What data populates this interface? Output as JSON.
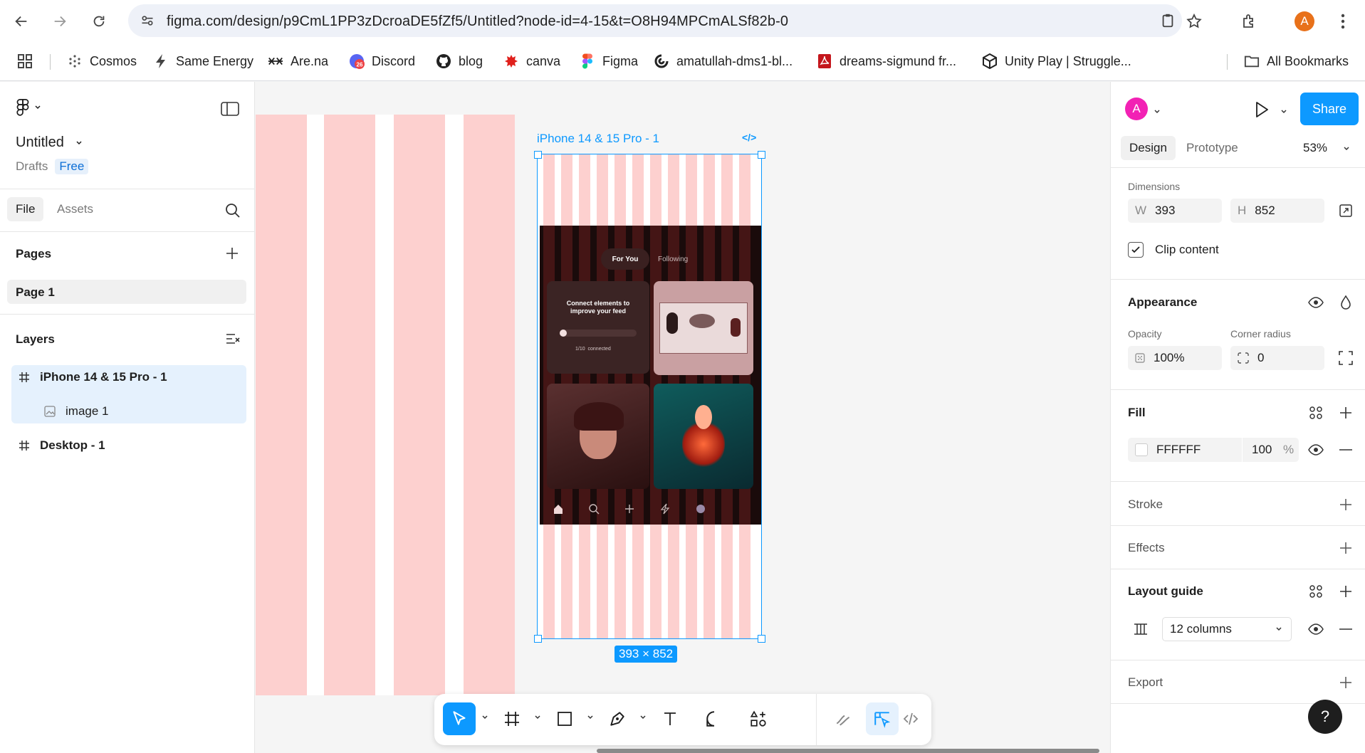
{
  "browser": {
    "url": "figma.com/design/p9CmL1PP3zDcroaDE5fZf5/Untitled?node-id=4-15&t=O8H94MPCmALSf82b-0",
    "profile_initial": "A",
    "bookmarks": [
      {
        "label": "Cosmos",
        "icon": "cosmos-icon"
      },
      {
        "label": "Same Energy",
        "icon": "bolt-icon"
      },
      {
        "label": "Are.na",
        "icon": "arena-icon"
      },
      {
        "label": "Discord",
        "icon": "discord-icon",
        "badge": "26"
      },
      {
        "label": "blog",
        "icon": "github-icon"
      },
      {
        "label": "canva",
        "icon": "canva-icon"
      },
      {
        "label": "Figma",
        "icon": "figma-icon"
      },
      {
        "label": "amatullah-dms1-bl...",
        "icon": "vercel-icon"
      },
      {
        "label": "dreams-sigmund fr...",
        "icon": "pdf-icon"
      },
      {
        "label": "Unity Play | Struggle...",
        "icon": "unity-icon"
      }
    ],
    "all_bookmarks": "All Bookmarks"
  },
  "file": {
    "title": "Untitled",
    "location": "Drafts",
    "plan": "Free"
  },
  "left_tabs": {
    "file": "File",
    "assets": "Assets"
  },
  "pages": {
    "title": "Pages",
    "items": [
      {
        "label": "Page 1"
      }
    ]
  },
  "layers": {
    "title": "Layers",
    "items": [
      {
        "label": "iPhone 14 & 15 Pro - 1",
        "type": "frame",
        "selected": true
      },
      {
        "label": "image 1",
        "type": "image",
        "selected": true
      },
      {
        "label": "Desktop - 1",
        "type": "frame",
        "selected": false
      }
    ]
  },
  "canvas": {
    "frame_label": "iPhone 14 & 15 Pro - 1",
    "frame_code_glyph": "</>",
    "dimension_badge": "393 × 852",
    "app": {
      "tab_active": "For You",
      "tab_inactive": "Following",
      "card_title": "Connect elements to improve your feed",
      "card_progress": "1/10",
      "card_progress_suffix": "connected"
    }
  },
  "toolbar": {
    "tools": [
      "move-tool",
      "frame-tool",
      "rectangle-tool",
      "pen-tool",
      "text-tool",
      "comment-tool",
      "actions-tool"
    ],
    "modes": [
      "draw-mode",
      "design-mode",
      "dev-mode"
    ],
    "active_tool": "move-tool"
  },
  "right": {
    "share": "Share",
    "avatar_initial": "A",
    "tabs": {
      "design": "Design",
      "prototype": "Prototype"
    },
    "zoom": "53%",
    "dimensions": {
      "label": "Dimensions",
      "w_label": "W",
      "w": "393",
      "h_label": "H",
      "h": "852"
    },
    "clip_content": "Clip content",
    "appearance": {
      "title": "Appearance",
      "opacity_label": "Opacity",
      "opacity": "100%",
      "radius_label": "Corner radius",
      "radius": "0"
    },
    "fill": {
      "title": "Fill",
      "hex": "FFFFFF",
      "opacity": "100",
      "unit": "%"
    },
    "stroke": "Stroke",
    "effects": "Effects",
    "layout_guide": {
      "title": "Layout guide",
      "value": "12 columns"
    },
    "export": "Export",
    "help": "?"
  },
  "colors": {
    "accent": "#0d99ff",
    "guide": "#fdd0cf",
    "brand_avatar": "#f221b4"
  }
}
